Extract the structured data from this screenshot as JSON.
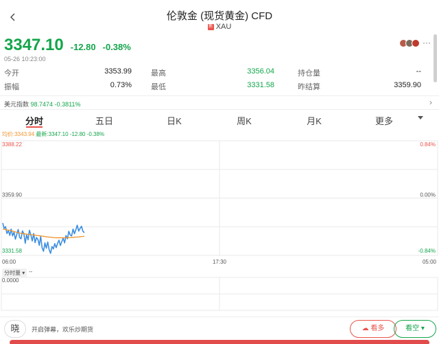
{
  "header": {
    "title": "伦敦金 (现货黄金) CFD",
    "flag_text": "新",
    "symbol": "XAU"
  },
  "quote": {
    "price": "3347.10",
    "change": "-12.80",
    "change_pct": "-0.38%",
    "time": "05-26 10:23:00",
    "more": "···"
  },
  "stats": {
    "open_label": "今开",
    "open": "3353.99",
    "high_label": "最高",
    "high": "3356.04",
    "oi_label": "持仓量",
    "oi": "--",
    "amp_label": "振幅",
    "amp": "0.73%",
    "low_label": "最低",
    "low": "3331.58",
    "prev_label": "昨结算",
    "prev": "3359.90"
  },
  "usd_index": {
    "label": "美元指数",
    "value": "98.7474",
    "change": "-0.3811%"
  },
  "tabs": [
    "分时",
    "五日",
    "日K",
    "周K",
    "月K",
    "更多"
  ],
  "avg_line": {
    "avg_label": "均价:",
    "avg_value": "3343.94",
    "latest_label": "最新:",
    "latest_value": "3347.10",
    "latest_change": "-12.80",
    "latest_pct": "-0.38%"
  },
  "volume": {
    "label": "分时量",
    "value": "--",
    "zero": "0.0000"
  },
  "bottom": {
    "chat_icon": "晓",
    "chat_text": "开启弹幕，欢乐炒期货",
    "bear_label": "看多",
    "bull_label": "看空"
  },
  "colors": {
    "up": "#13a54b",
    "down": "#e9534b",
    "price_line": "#3b8de0",
    "avg_line": "#f0932b",
    "grid": "#e9e9e9"
  },
  "chart_data": {
    "type": "line",
    "x_ticks": [
      "06:00",
      "17:30",
      "05:00"
    ],
    "y_ticks_left": [
      "3388.22",
      "3359.90",
      "3331.58"
    ],
    "y_ticks_right": [
      "0.84%",
      "0.00%",
      "-0.84%"
    ],
    "ylim": [
      3331.58,
      3388.22
    ],
    "reference": 3359.9,
    "series": [
      {
        "values": [
          3347.6,
          3344.9,
          3345.8,
          3342.4,
          3343.9,
          3341.5,
          3344.6,
          3341.2,
          3343.1,
          3339.6,
          3342.0,
          3344.4,
          3340.5,
          3339.8,
          3343.7,
          3342.3,
          3337.6,
          3341.8,
          3339.3,
          3344.0,
          3341.7,
          3338.7,
          3342.4,
          3337.9,
          3340.4,
          3339.5,
          3336.6,
          3341.0,
          3335.3,
          3333.6,
          3337.8,
          3335.1,
          3338.2,
          3334.5,
          3332.6,
          3336.0,
          3334.8,
          3337.4,
          3335.4,
          3337.5,
          3339.1,
          3336.5,
          3338.4,
          3340.1,
          3337.8,
          3341.4,
          3339.8,
          3343.5,
          3341.7,
          3341.2,
          3344.6,
          3342.3,
          3344.3,
          3346.5,
          3343.6,
          3344.9,
          3346.0,
          3343.6,
          3342.8
        ]
      },
      {
        "values": [
          3344.6,
          3344.5,
          3344.3,
          3344.2,
          3344.1,
          3344.0,
          3343.8,
          3343.6,
          3343.4,
          3343.2,
          3343.0,
          3342.8,
          3342.7,
          3342.5,
          3342.4,
          3342.3,
          3342.2,
          3342.1,
          3342.0,
          3341.9,
          3341.8,
          3341.8,
          3341.7,
          3341.6,
          3341.5,
          3341.4,
          3341.3,
          3341.2,
          3341.1,
          3341.0,
          3340.9,
          3340.8,
          3340.7,
          3340.6,
          3340.6,
          3340.5,
          3340.4,
          3340.4,
          3340.3,
          3340.3,
          3340.3,
          3340.3,
          3340.3,
          3340.3,
          3340.3,
          3340.3,
          3340.4,
          3340.4,
          3340.4,
          3340.5,
          3340.5,
          3340.6,
          3340.6,
          3340.7,
          3340.7,
          3340.8,
          3340.9,
          3340.9,
          3341.0
        ]
      }
    ]
  }
}
